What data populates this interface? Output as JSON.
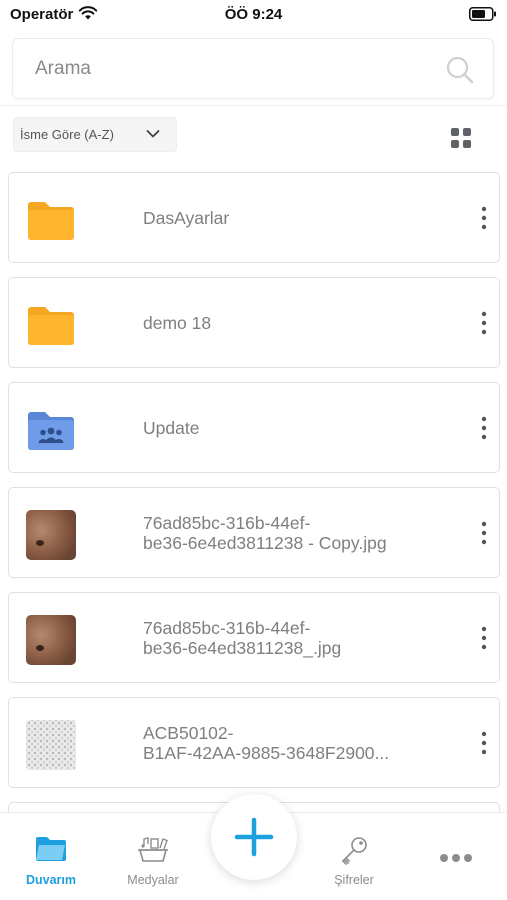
{
  "status_bar": {
    "carrier": "Operatör",
    "time": "ÖÖ 9:24"
  },
  "search": {
    "placeholder": "Arama"
  },
  "sort": {
    "selected": "İsme Göre (A-Z)"
  },
  "files": [
    {
      "name": "DasAyarlar",
      "type": "folder",
      "color": "#FFB52E"
    },
    {
      "name": "demo 18",
      "type": "folder",
      "color": "#FFB52E"
    },
    {
      "name": "Update",
      "type": "shared-folder",
      "color": "#6F9BE8"
    },
    {
      "name": "76ad85bc-316b-44ef-\nbe36-6e4ed3811238 - Copy.jpg",
      "type": "image"
    },
    {
      "name": "76ad85bc-316b-44ef-\nbe36-6e4ed3811238_.jpg",
      "type": "image"
    },
    {
      "name": "ACB50102-\nB1AF-42AA-9885-3648F2900...",
      "type": "image-pattern"
    }
  ],
  "tabs": [
    {
      "label": "Duvarım",
      "icon": "folder-icon",
      "active": true
    },
    {
      "label": "Medyalar",
      "icon": "media-icon",
      "active": false
    },
    {
      "label": "Şifreler",
      "icon": "key-icon",
      "active": false
    },
    {
      "label": "",
      "icon": "more-horizontal-icon",
      "active": false
    }
  ],
  "colors": {
    "accent": "#1E9FE0",
    "folder": "#FFB52E",
    "shared_folder": "#6F9BE8",
    "text_muted": "#7F7F7F"
  }
}
